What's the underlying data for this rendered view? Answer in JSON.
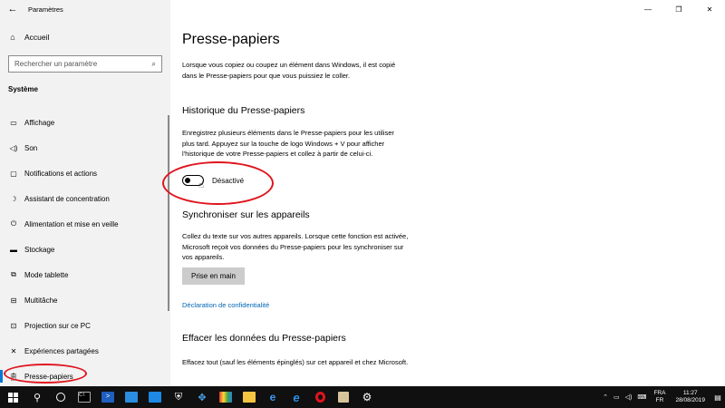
{
  "window": {
    "app_title": "Paramètres",
    "controls": {
      "minimize": "—",
      "maximize": "❐",
      "close": "✕"
    }
  },
  "sidebar": {
    "home_label": "Accueil",
    "search_placeholder": "Rechercher un paramètre",
    "section": "Système",
    "items": [
      {
        "icon": "monitor-icon",
        "label": "Affichage"
      },
      {
        "icon": "speaker-icon",
        "label": "Son"
      },
      {
        "icon": "notification-icon",
        "label": "Notifications et actions"
      },
      {
        "icon": "moon-icon",
        "label": "Assistant de concentration"
      },
      {
        "icon": "power-icon",
        "label": "Alimentation et mise en veille"
      },
      {
        "icon": "storage-icon",
        "label": "Stockage"
      },
      {
        "icon": "tablet-icon",
        "label": "Mode tablette"
      },
      {
        "icon": "multitask-icon",
        "label": "Multitâche"
      },
      {
        "icon": "project-icon",
        "label": "Projection sur ce PC"
      },
      {
        "icon": "share-icon",
        "label": "Expériences partagées"
      },
      {
        "icon": "clipboard-icon",
        "label": "Presse-papiers"
      }
    ]
  },
  "main": {
    "title": "Presse-papiers",
    "intro": "Lorsque vous copiez ou coupez un élément dans Windows, il est copié dans le Presse-papiers pour que vous puissiez le coller.",
    "history": {
      "heading": "Historique du Presse-papiers",
      "description": "Enregistrez plusieurs éléments dans le Presse-papiers pour les utiliser plus tard. Appuyez sur la touche de logo Windows + V pour afficher l'historique de votre Presse-papiers et collez à partir de celui-ci.",
      "toggle_state": "Désactivé",
      "toggle_on": false
    },
    "sync": {
      "heading": "Synchroniser sur les appareils",
      "description": "Collez du texte sur vos autres appareils. Lorsque cette fonction est activée, Microsoft reçoit vos données du Presse-papiers pour les synchroniser sur vos appareils.",
      "button": "Prise en main",
      "privacy_link": "Déclaration de confidentialité"
    },
    "clear": {
      "heading": "Effacer les données du Presse-papiers",
      "description": "Effacez tout (sauf les éléments épinglés) sur cet appareil et chez Microsoft."
    }
  },
  "taskbar": {
    "apps": [
      "cortana-search-icon",
      "task-view-icon",
      "cmd-icon",
      "powershell-icon",
      "remote-desktop-icon",
      "photos-icon",
      "security-icon",
      "dropbox-icon",
      "paint-icon",
      "file-explorer-icon",
      "edge-icon",
      "ie-icon",
      "opera-icon",
      "notepad-icon",
      "settings-icon"
    ],
    "tray": {
      "lang_top": "FRA",
      "lang_bottom": "FR",
      "time": "11:27",
      "date": "28/08/2019"
    }
  },
  "colors": {
    "sidebar_bg": "#f2f2f2",
    "accent": "#0078d7",
    "link": "#0066b4",
    "annotation": "#e0141e",
    "taskbar_bg": "#101010"
  }
}
